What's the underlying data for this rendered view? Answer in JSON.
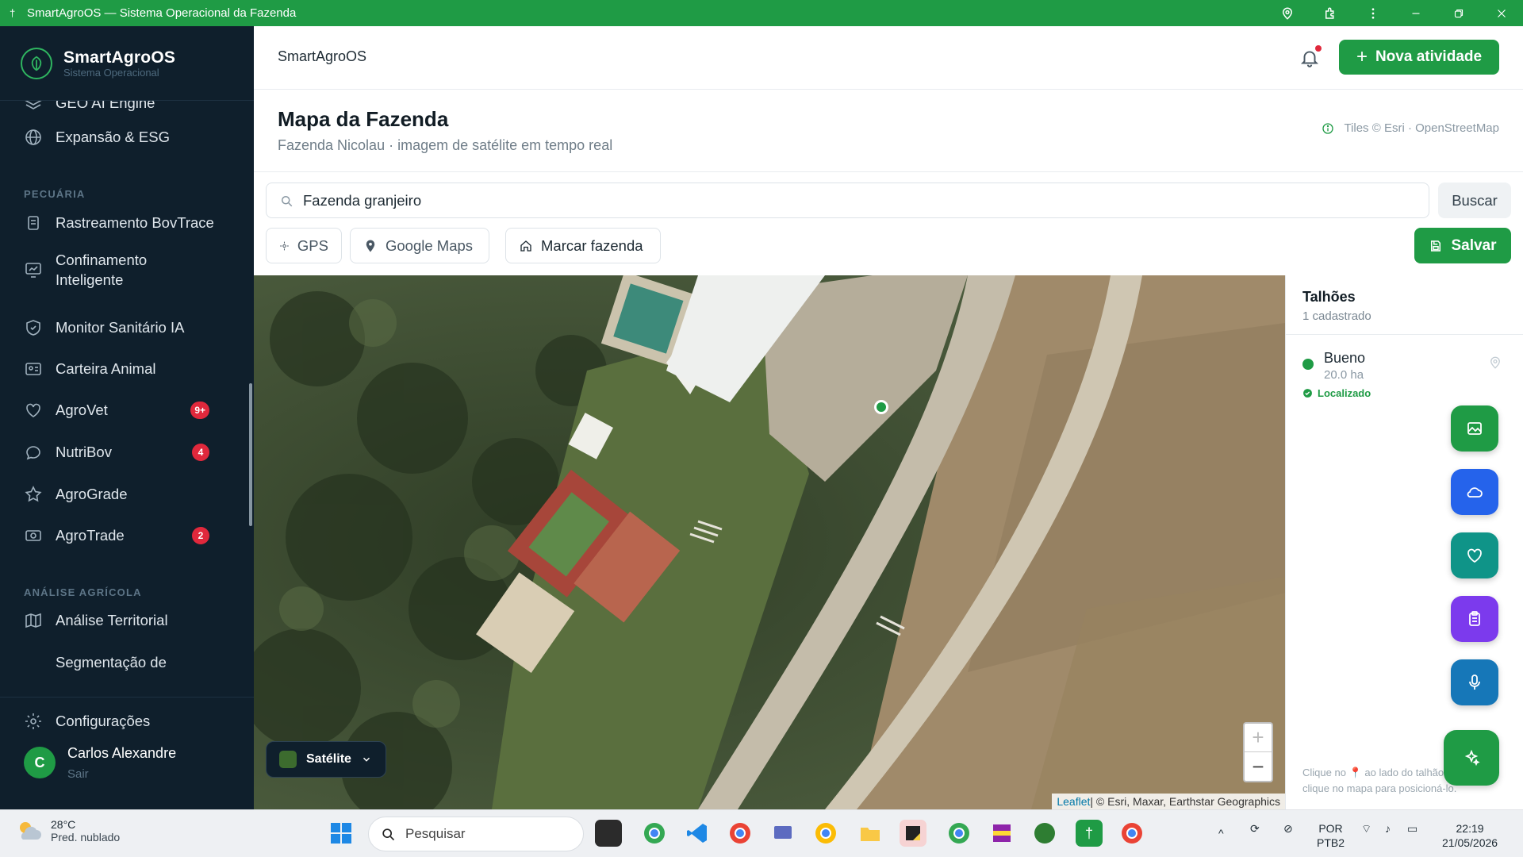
{
  "window": {
    "title": "SmartAgroOS — Sistema Operacional da Fazenda"
  },
  "brand": {
    "name": "SmartAgroOS",
    "subtitle": "Sistema Operacional"
  },
  "sidebar": {
    "items_top": [
      {
        "label": "GEO AI Engine"
      },
      {
        "label": "Expansão & ESG"
      }
    ],
    "section_pecuaria": "PECUÁRIA",
    "items_pecuaria": [
      {
        "label": "Rastreamento BovTrace"
      },
      {
        "label": "Confinamento Inteligente"
      },
      {
        "label": "Monitor Sanitário IA"
      },
      {
        "label": "Carteira Animal"
      },
      {
        "label": "AgroVet",
        "badge": "9+"
      },
      {
        "label": "NutriBov",
        "badge": "4"
      },
      {
        "label": "AgroGrade"
      },
      {
        "label": "AgroTrade",
        "badge": "2"
      }
    ],
    "section_analise": "ANÁLISE AGRÍCOLA",
    "items_analise": [
      {
        "label": "Análise Territorial"
      },
      {
        "label": "Segmentação de"
      }
    ],
    "settings": "Configurações",
    "user": {
      "initial": "C",
      "name": "Carlos Alexandre",
      "logout": "Sair"
    }
  },
  "header": {
    "breadcrumb": "SmartAgroOS",
    "new_activity": "Nova atividade"
  },
  "page": {
    "title": "Mapa da Fazenda",
    "subtitle": "Fazenda Nicolau · imagem de satélite em tempo real",
    "tiles_credit": "Tiles © Esri · OpenStreetMap"
  },
  "search": {
    "value": "Fazenda granjeiro",
    "button": "Buscar"
  },
  "tools": {
    "gps": "GPS",
    "google_maps": "Google Maps",
    "mark_farm": "Marcar fazenda",
    "save": "Salvar"
  },
  "map": {
    "layer": "Satélite",
    "zoom_in": "+",
    "zoom_out": "−",
    "attribution_leaflet": "Leaflet",
    "attribution_rest": " | © Esri, Maxar, Earthstar Geographics"
  },
  "panel": {
    "title": "Talhões",
    "count": "1 cadastrado",
    "plots": [
      {
        "name": "Bueno",
        "area": "20.0 ha",
        "status": "Localizado"
      }
    ],
    "hint_a": "Clique no",
    "hint_b": "ao lado do talhão e",
    "hint_c": "clique no mapa para posicioná-lo."
  },
  "fab_icons": [
    "image-icon",
    "cloud-icon",
    "heart-icon",
    "clipboard-icon",
    "microphone-icon",
    "sparkles-icon"
  ],
  "fab_colors": [
    "#1f9b45",
    "#2563eb",
    "#0f9488",
    "#7c3aed",
    "#1677b8",
    "#1f9b45"
  ],
  "taskbar": {
    "temperature": "28°C",
    "weather": "Pred. nublado",
    "search": "Pesquisar",
    "lang1": "POR",
    "lang2": "PTB2",
    "time": "22:19",
    "date": "21/05/2026"
  }
}
